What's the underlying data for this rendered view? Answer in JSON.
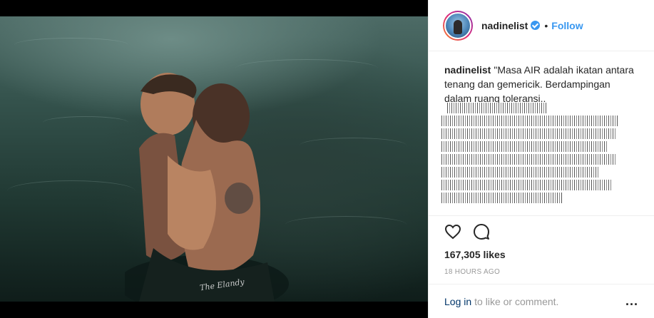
{
  "post": {
    "image_watermark": "The Elandy",
    "username": "nadinelist",
    "follow_label": "Follow",
    "separator": "•",
    "caption_user": "nadinelist",
    "caption_text": "\"Masa AIR adalah ikatan antara tenang dan gemericik. Berdampingan dalam ruang toleransi..",
    "likes": "167,305 likes",
    "time_ago": "18 HOURS AGO",
    "login_label": "Log in",
    "login_rest": "to like or comment.",
    "more_label": "...",
    "icons": {
      "like": "heart-icon",
      "comment": "comment-icon",
      "verified": "verified-badge-icon",
      "more": "more-options-icon"
    },
    "colors": {
      "accent": "#3897f0",
      "link": "#003569",
      "muted": "#999999",
      "text": "#262626"
    }
  }
}
